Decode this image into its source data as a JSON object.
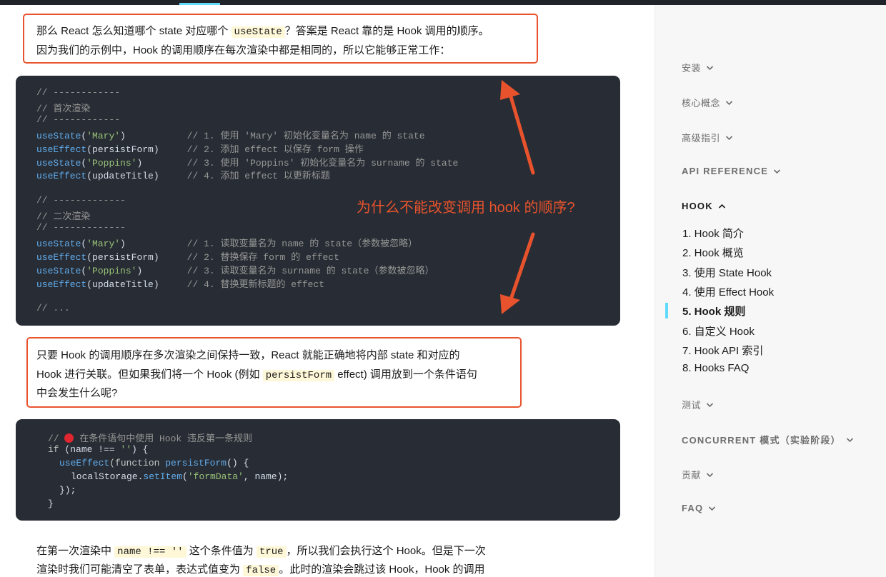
{
  "colors": {
    "accent": "#61dafb",
    "annotation": "#e8532d",
    "code_bg": "#282c34"
  },
  "para1": {
    "line1_pre": "那么 React 怎么知道哪个 state 对应哪个 ",
    "line1_code": "useState",
    "line1_post": "？答案是 React 靠的是 Hook 调用的顺序。",
    "line2": "因为我们的示例中，Hook 的调用顺序在每次渲染中都是相同的，所以它能够正常工作："
  },
  "code1": {
    "lines": [
      {
        "fn": "",
        "args": "",
        "comment": "// ------------"
      },
      {
        "fn": "",
        "args": "",
        "comment": "// 首次渲染"
      },
      {
        "fn": "",
        "args": "",
        "comment": "// ------------"
      },
      {
        "fn": "useState",
        "str": "'Mary'",
        "args": "",
        "pad": "           ",
        "comment": "// 1. 使用 'Mary' 初始化变量名为 name 的 state"
      },
      {
        "fn": "useEffect",
        "str": "",
        "args": "persistForm",
        "pad": "     ",
        "comment": "// 2. 添加 effect 以保存 form 操作"
      },
      {
        "fn": "useState",
        "str": "'Poppins'",
        "args": "",
        "pad": "        ",
        "comment": "// 3. 使用 'Poppins' 初始化变量名为 surname 的 state"
      },
      {
        "fn": "useEffect",
        "str": "",
        "args": "updateTitle",
        "pad": "     ",
        "comment": "// 4. 添加 effect 以更新标题"
      },
      {
        "fn": "",
        "args": "",
        "comment": ""
      },
      {
        "fn": "",
        "args": "",
        "comment": "// -------------"
      },
      {
        "fn": "",
        "args": "",
        "comment": "// 二次渲染"
      },
      {
        "fn": "",
        "args": "",
        "comment": "// -------------"
      },
      {
        "fn": "useState",
        "str": "'Mary'",
        "args": "",
        "pad": "           ",
        "comment": "// 1. 读取变量名为 name 的 state（参数被忽略）"
      },
      {
        "fn": "useEffect",
        "str": "",
        "args": "persistForm",
        "pad": "     ",
        "comment": "// 2. 替换保存 form 的 effect"
      },
      {
        "fn": "useState",
        "str": "'Poppins'",
        "args": "",
        "pad": "        ",
        "comment": "// 3. 读取变量名为 surname 的 state（参数被忽略）"
      },
      {
        "fn": "useEffect",
        "str": "",
        "args": "updateTitle",
        "pad": "     ",
        "comment": "// 4. 替换更新标题的 effect"
      },
      {
        "fn": "",
        "args": "",
        "comment": ""
      },
      {
        "fn": "",
        "args": "",
        "comment": "// ..."
      }
    ]
  },
  "annotation": "为什么不能改变调用 hook 的顺序?",
  "para2": {
    "line1": "只要 Hook 的调用顺序在多次渲染之间保持一致，React 就能正确地将内部 state 和对应的",
    "line2_pre": "Hook 进行关联。但如果我们将一个 Hook (例如 ",
    "line2_code": "persistForm",
    "line2_post": " effect) 调用放到一个条件语句",
    "line3": "中会发生什么呢?"
  },
  "code2": {
    "comment_pre": "// ",
    "comment_post": " 在条件语句中使用 Hook 违反第一条规则",
    "if_kw": "if",
    "if_cond": " (name !== ",
    "if_str": "''",
    "if_end": ") {",
    "effect_fn": "useEffect",
    "effect_open": "(function ",
    "effect_name": "persistForm",
    "effect_end": "() {",
    "ls_obj": "localStorage.",
    "ls_fn": "setItem",
    "ls_open": "(",
    "ls_str": "'formData'",
    "ls_end": ", name);",
    "close1": "});",
    "close2": "}"
  },
  "para3": {
    "l1_pre": "在第一次渲染中 ",
    "l1_code1": "name !== ''",
    "l1_mid": " 这个条件值为 ",
    "l1_code2": "true",
    "l1_post": "，所以我们会执行这个 Hook。但是下一次",
    "l2_pre": "渲染时我们可能清空了表单，表达式值变为 ",
    "l2_code": "false",
    "l2_post": "。此时的渲染会跳过该 Hook，Hook 的调用"
  },
  "sidebar": {
    "sections": [
      {
        "label": "安装",
        "expanded": false
      },
      {
        "label": "核心概念",
        "expanded": false
      },
      {
        "label": "高级指引",
        "expanded": false
      },
      {
        "label": "API REFERENCE",
        "expanded": false
      },
      {
        "label": "HOOK",
        "expanded": true
      },
      {
        "label": "测试",
        "expanded": false
      },
      {
        "label": "CONCURRENT 模式（实验阶段）",
        "expanded": false
      },
      {
        "label": "贡献",
        "expanded": false
      },
      {
        "label": "FAQ",
        "expanded": false
      }
    ],
    "hook_items": [
      "1. Hook 简介",
      "2. Hook 概览",
      "3. 使用 State Hook",
      "4. 使用 Effect Hook",
      "5. Hook 规则",
      "6. 自定义 Hook",
      "7. Hook API 索引",
      "8. Hooks FAQ"
    ],
    "current_item": "5. Hook 规则"
  }
}
